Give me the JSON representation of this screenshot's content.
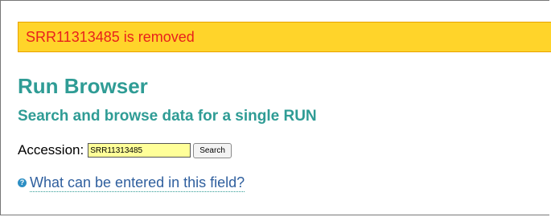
{
  "alert": {
    "message": "SRR11313485 is removed"
  },
  "header": {
    "title": "Run Browser",
    "subtitle": "Search and browse data for a single RUN"
  },
  "search": {
    "label": "Accession:",
    "value": "SRR11313485",
    "button_label": "Search"
  },
  "help": {
    "icon_name": "help-icon",
    "icon_glyph": "?",
    "link_text": "What can be entered in this field?"
  },
  "colors": {
    "alert_background": "#ffd42a",
    "alert_text": "#e8211c",
    "heading": "#2f9c95",
    "input_background": "#ffff99",
    "link": "#2f5f9e"
  }
}
